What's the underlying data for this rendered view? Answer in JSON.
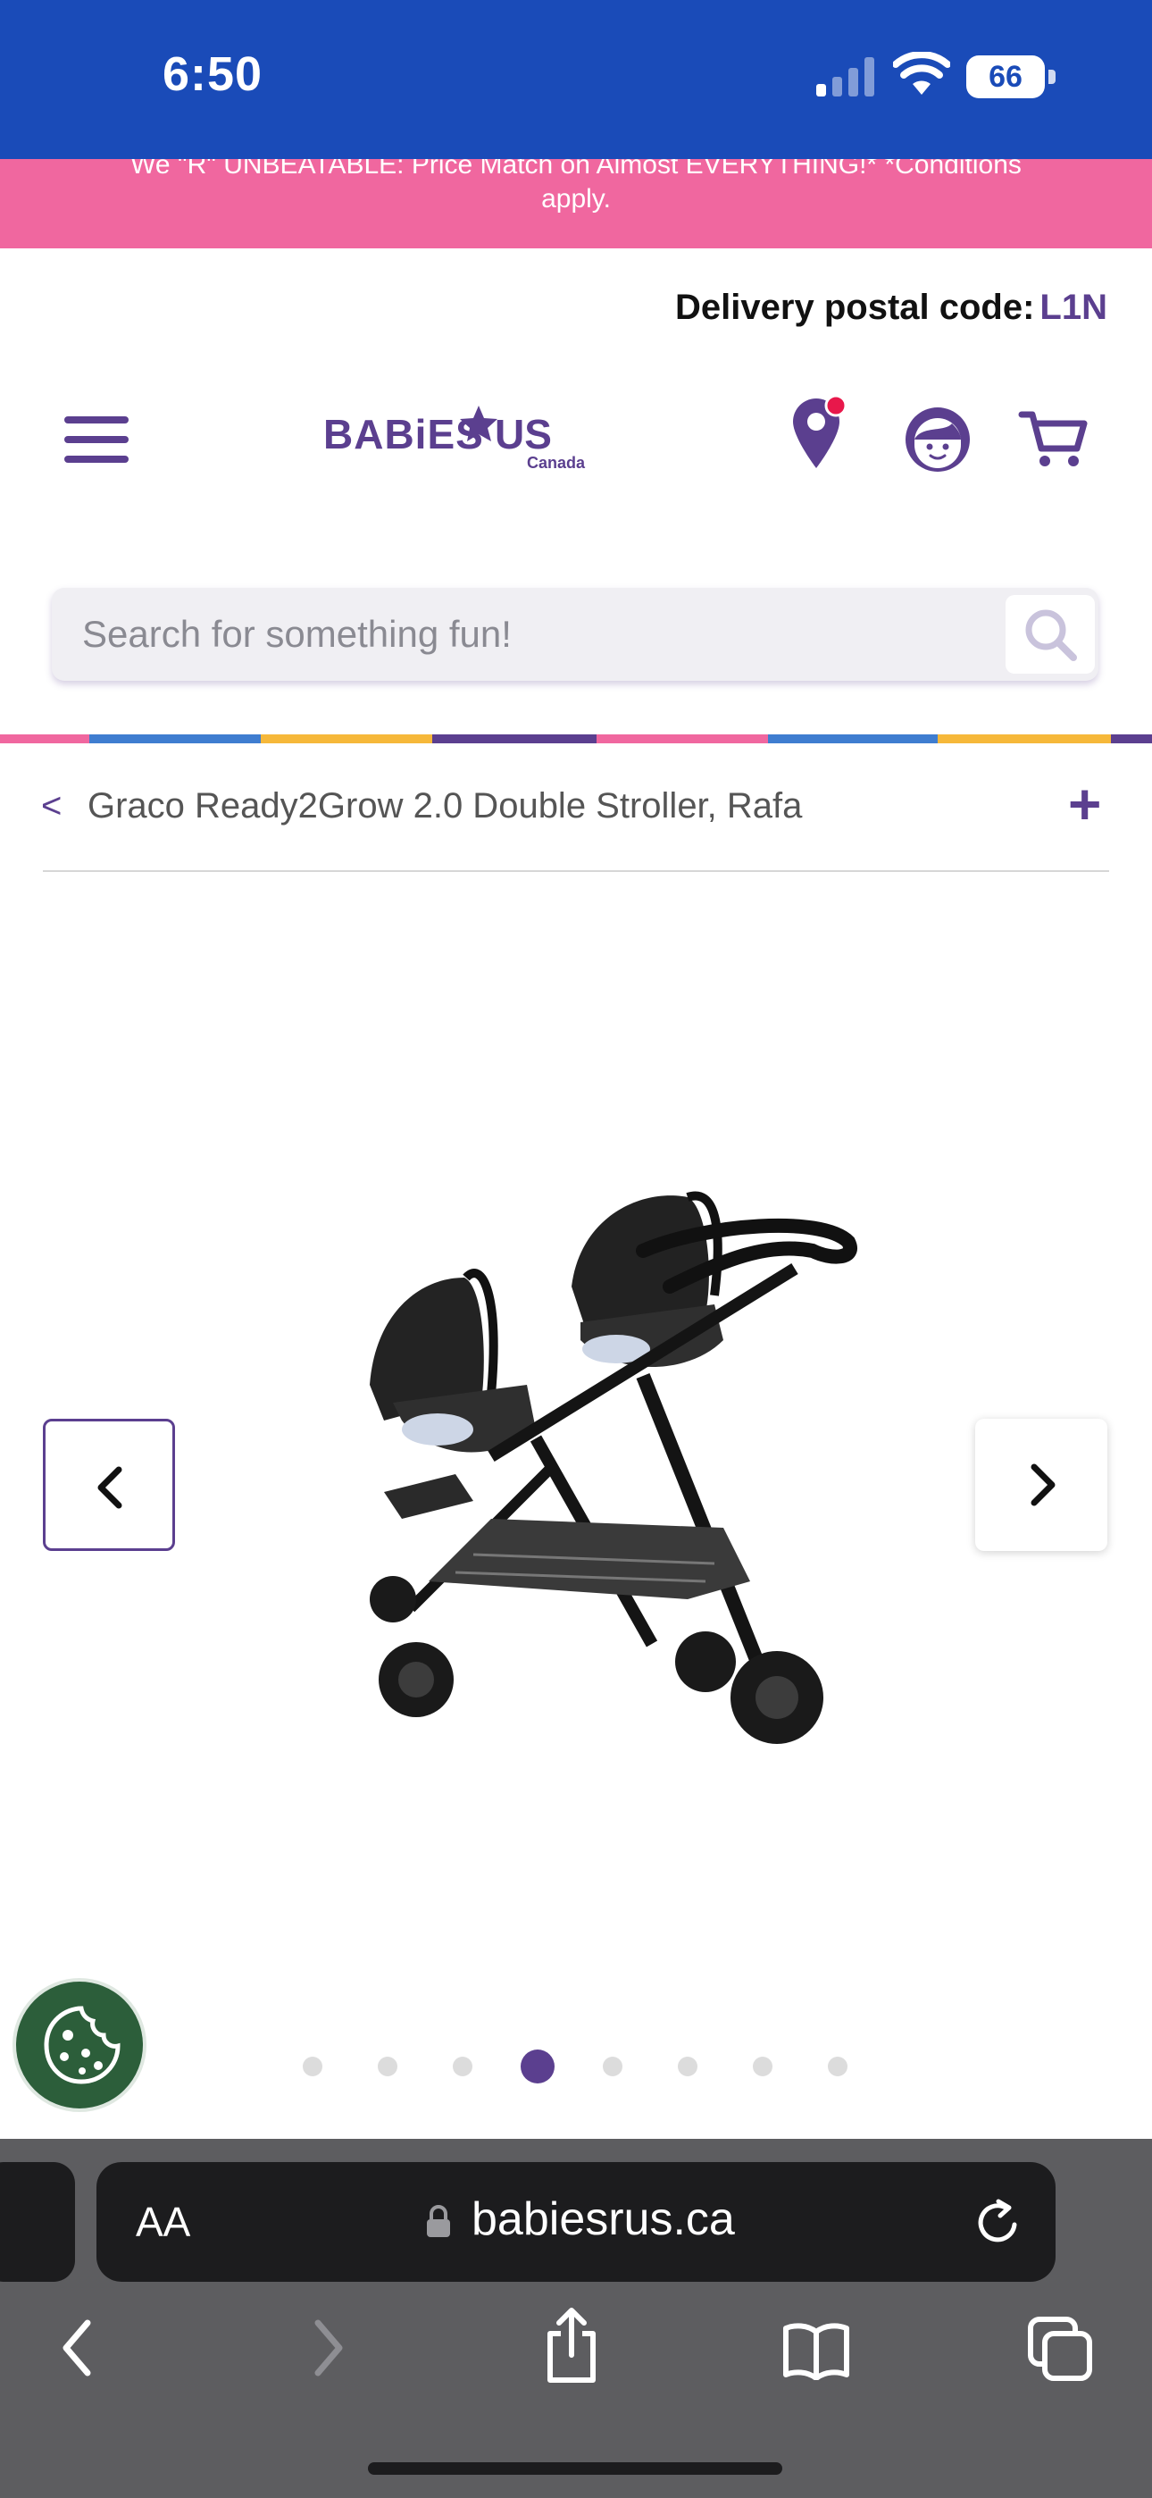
{
  "status_bar": {
    "time": "6:50",
    "battery": "66"
  },
  "promo": {
    "line1": "We \"R\" UNBEATABLE: Price Match on Almost EVERYTHING!* *Conditions",
    "line2": "apply."
  },
  "delivery": {
    "label": "Delivery postal code:",
    "code": "L1N"
  },
  "search": {
    "placeholder": "Search for something fun!"
  },
  "breadcrumb": {
    "back": "<",
    "title": "Graco Ready2Grow 2.0 Double Stroller, Rafa",
    "expand": "+"
  },
  "gallery": {
    "total": 8,
    "active_index": 3
  },
  "browser": {
    "text_size": "AA",
    "url": "babiesrus.ca"
  },
  "colors": {
    "brand_purple": "#5b3f8f",
    "status_blue": "#1a4bb8",
    "promo_pink": "#f0679f",
    "stripe": [
      "#f0679f",
      "#3f7dd0",
      "#f6b83a",
      "#5b3f8f",
      "#f0679f",
      "#3f7dd0",
      "#f6b83a",
      "#5b3f8f"
    ]
  },
  "icons": [
    "menu-icon",
    "store-locator-icon",
    "account-icon",
    "cart-icon",
    "search-icon",
    "chevron-left-icon",
    "chevron-right-icon",
    "cookie-icon",
    "lock-icon",
    "reload-icon",
    "back-icon",
    "forward-icon",
    "share-icon",
    "bookmarks-icon",
    "tabs-icon"
  ]
}
